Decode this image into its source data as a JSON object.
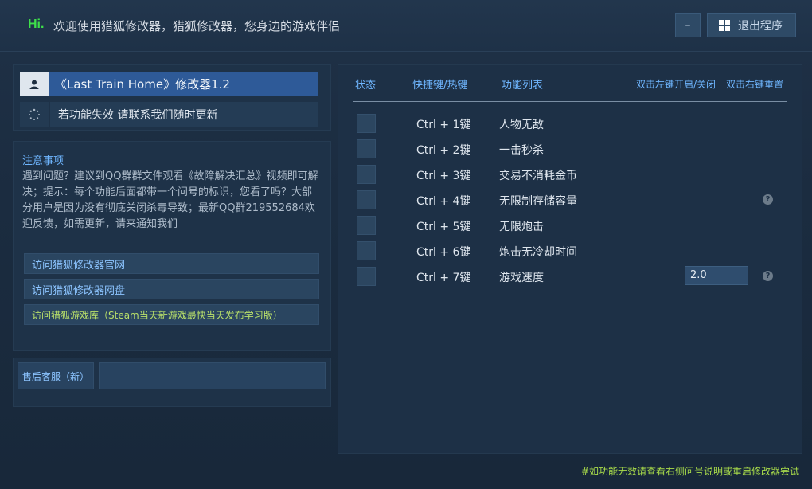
{
  "header": {
    "hi": "Hi.",
    "welcome": "欢迎使用猎狐修改器，猎狐修改器，您身边的游戏伴侣",
    "minimize_label": "–",
    "exit_label": "退出程序"
  },
  "game": {
    "title": "《Last Train Home》修改器1.2",
    "notice": "若功能失效  请联系我们随时更新"
  },
  "notes": {
    "title": "注意事项",
    "body": "遇到问题？建议到QQ群群文件观看《故障解决汇总》视频即可解决；提示：每个功能后面都带一个问号的标识，您看了吗？大部分用户是因为没有彻底关闭杀毒导致；最新QQ群219552684欢迎反馈，如需更新，请来通知我们"
  },
  "links": [
    {
      "label": "访问猎狐修改器官网"
    },
    {
      "label": "访问猎狐修改器网盘"
    },
    {
      "label": "访问猎狐游戏库（Steam当天新游戏最快当天发布学习版）"
    }
  ],
  "support": {
    "label": "售后客服（新）"
  },
  "table": {
    "headers": {
      "state": "状态",
      "hotkey": "快捷键/热键",
      "functions": "功能列表",
      "toggle_hint": "双击左键开启/关闭",
      "reset_hint": "双击右键重置"
    },
    "rows": [
      {
        "key": "Ctrl  +  1键",
        "name": "人物无敌"
      },
      {
        "key": "Ctrl  +  2键",
        "name": "一击秒杀"
      },
      {
        "key": "Ctrl  +  3键",
        "name": "交易不消耗金币"
      },
      {
        "key": "Ctrl  +  4键",
        "name": "无限制存储容量",
        "help": "?"
      },
      {
        "key": "Ctrl  +  5键",
        "name": "无限炮击"
      },
      {
        "key": "Ctrl  +  6键",
        "name": "炮击无冷却时间"
      },
      {
        "key": "Ctrl  +  7键",
        "name": "游戏速度",
        "value": "2.0",
        "help": "?"
      }
    ]
  },
  "footer": "#如功能无效请查看右侧问号说明或重启修改器尝试",
  "icons": {
    "user": "user-icon",
    "spinner": "loading-icon",
    "windows": "windows-icon",
    "help": "help-icon"
  }
}
